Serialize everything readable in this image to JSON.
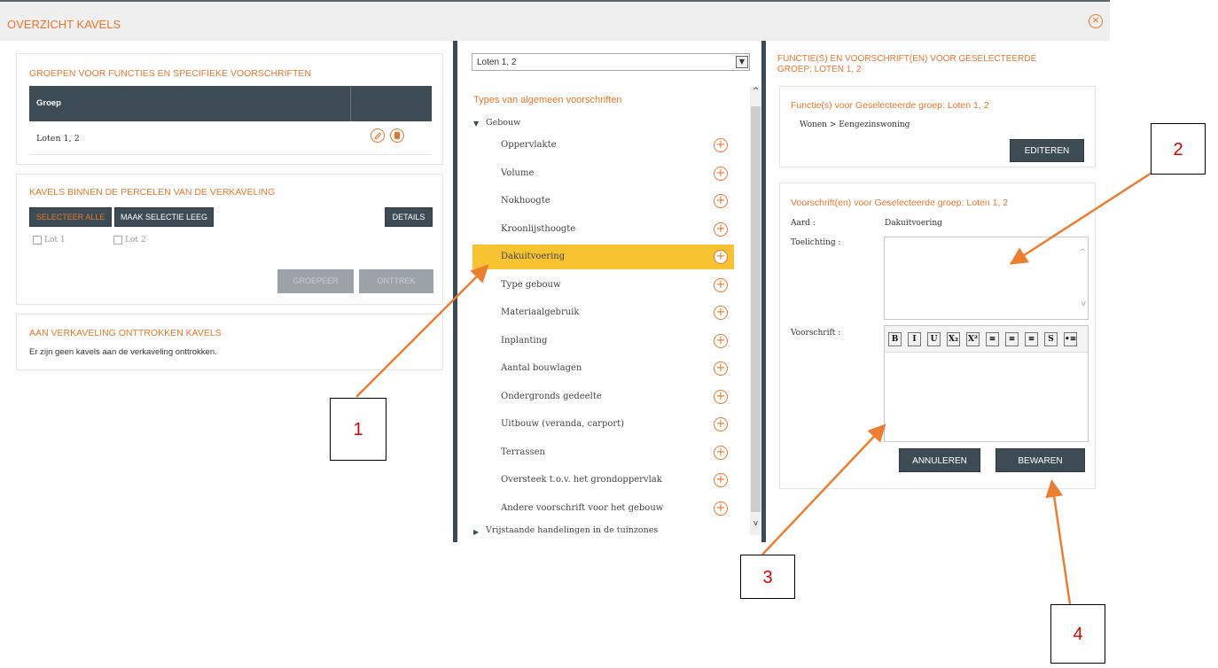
{
  "header": {
    "title": "OVERZICHT KAVELS",
    "close_icon": "close-circle-icon"
  },
  "groups_panel": {
    "title": "GROEPEN VOOR FUNCTIES EN SPECIFIEKE VOORSCHRIFTEN",
    "column_header": "Groep",
    "rows": [
      {
        "label": "Loten 1, 2",
        "edit_icon": "edit-icon",
        "delete_icon": "delete-icon"
      }
    ]
  },
  "kavels_panel": {
    "title": "KAVELS BINNEN DE PERCELEN VAN DE VERKAVELING",
    "select_all": "SELECTEER ALLE",
    "clear_selection": "MAAK SELECTIE LEEG",
    "details": "DETAILS",
    "lots": [
      "Lot 1",
      "Lot 2"
    ],
    "group_btn": "GROEPEER",
    "withdraw_btn": "ONTTREK"
  },
  "withdrawn_panel": {
    "title": "AAN VERKAVELING ONTTROKKEN KAVELS",
    "message": "Er zijn geen kavels aan de verkaveling onttrokken."
  },
  "middle": {
    "select_value": "Loten 1, 2",
    "section_title": "Types van algemeen voorschriften",
    "category": "Gebouw",
    "items": [
      "Oppervlakte",
      "Volume",
      "Nokhoogte",
      "Kroonlijsthoogte",
      "Dakuitvoering",
      "Type gebouw",
      "Materiaalgebruik",
      "Inplanting",
      "Aantal bouwlagen",
      "Ondergronds gedeelte",
      "Uitbouw (veranda, carport)",
      "Terrassen",
      "Oversteek t.o.v. het grondoppervlak",
      "Andere voorschrift voor het gebouw"
    ],
    "selected_index": 4,
    "collapsed_category": "Vrijstaande handelingen in de tuinzones"
  },
  "right": {
    "title_line1": "FUNCTIE(S) EN VOORSCHRIFT(EN) VOOR GESELECTEERDE",
    "title_line2": "GROEP: LOTEN 1, 2",
    "functions_title": "Functie(s) voor Geselecteerde groep: Loten 1, 2",
    "function_value": "Wonen > Eengezinswoning",
    "edit_btn": "EDITEREN",
    "rules_title": "Voorschrift(en) voor Geselecteerde groep: Loten 1, 2",
    "aard_label": "Aard :",
    "aard_value": "Dakuitvoering",
    "toelichting_label": "Toelichting :",
    "voorschrift_label": "Voorschrift :",
    "toolbar": [
      "B",
      "I",
      "U",
      "X₂",
      "X²",
      "≡",
      "≡",
      "≡",
      "S",
      "•≡"
    ],
    "cancel_btn": "ANNULEREN",
    "save_btn": "BEWAREN"
  },
  "annotations": [
    "1",
    "2",
    "3",
    "4"
  ],
  "colors": {
    "accent": "#e8772e",
    "dark": "#3d4b55",
    "highlight": "#f7c331"
  }
}
